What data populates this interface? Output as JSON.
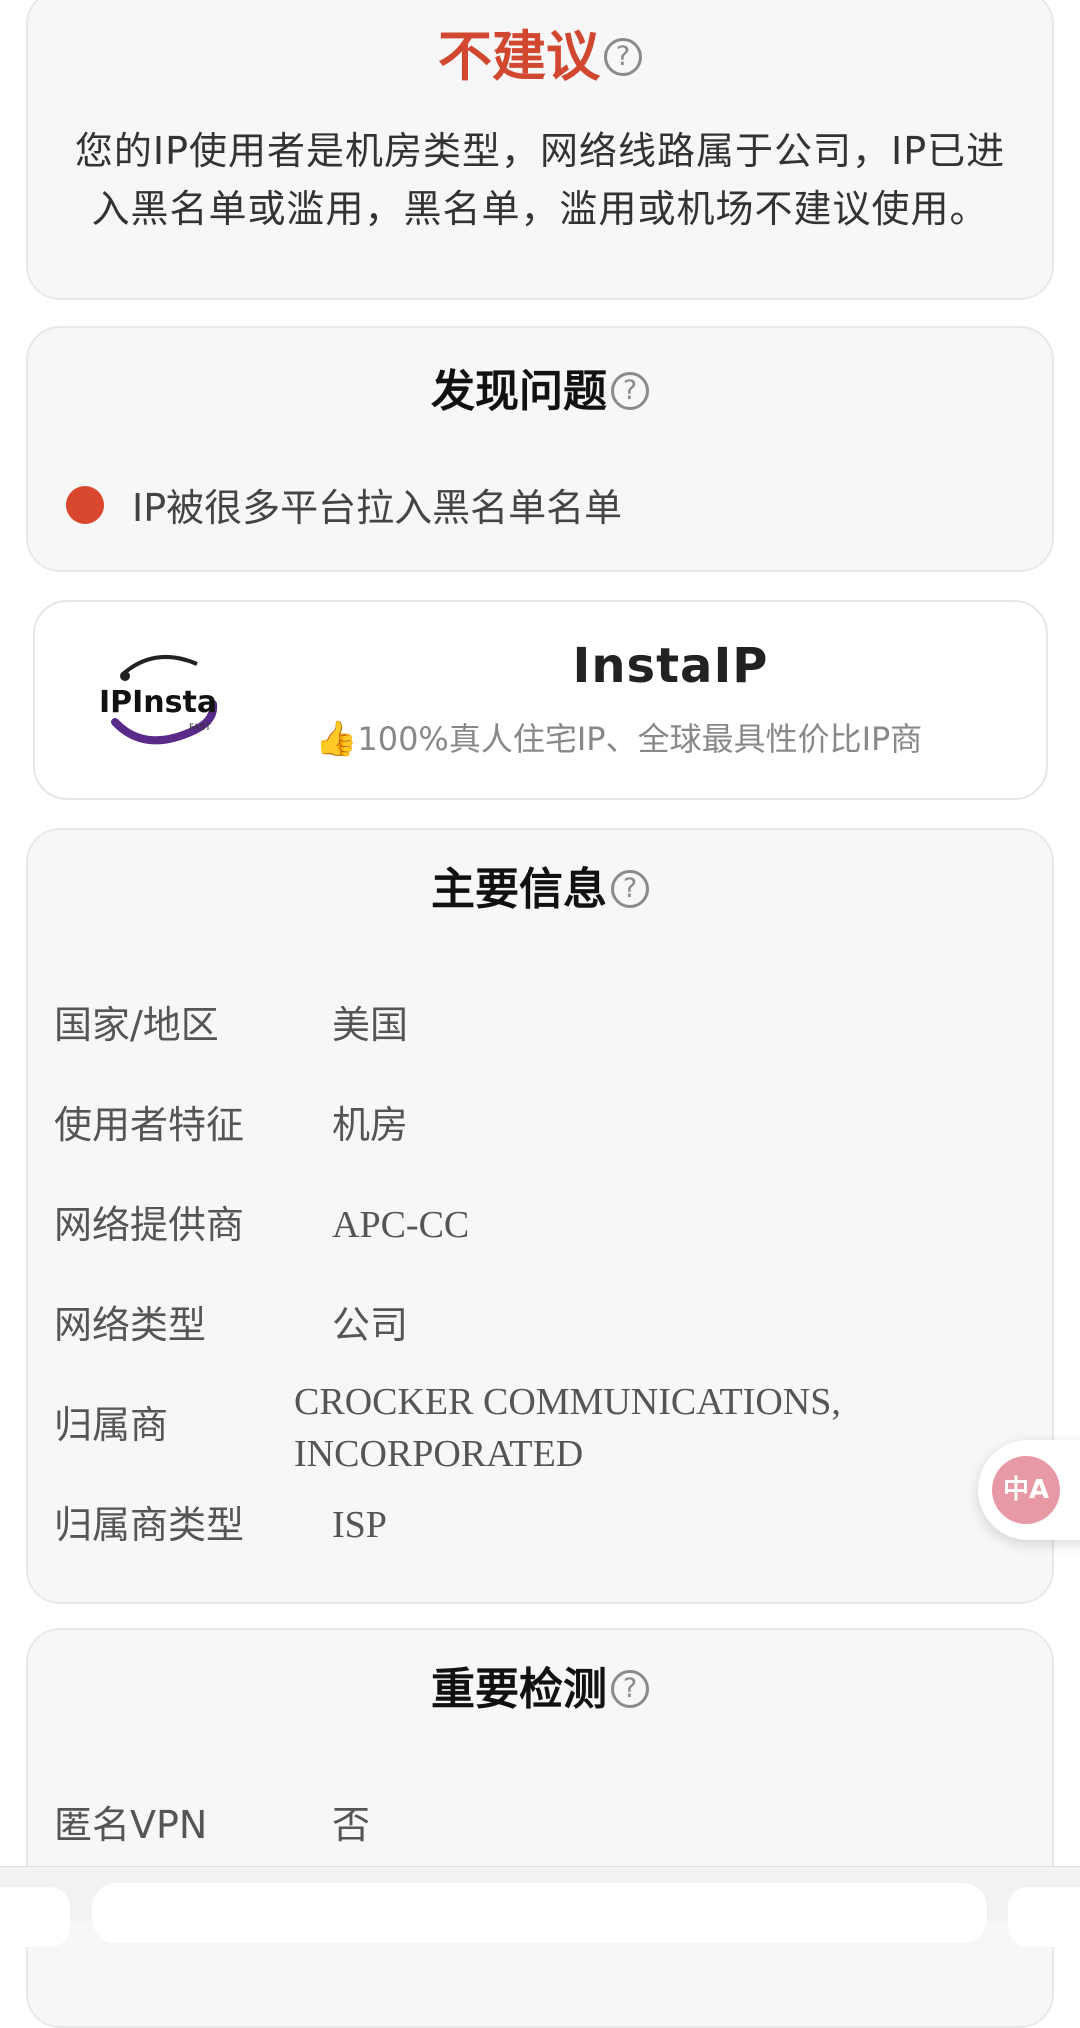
{
  "verdict": {
    "title": "不建议",
    "help": "?",
    "description": "您的IP使用者是机房类型，网络线路属于公司，IP已进入黑名单或滥用，黑名单，滥用或机场不建议使用。"
  },
  "issues": {
    "title": "发现问题",
    "help": "?",
    "items": [
      {
        "text": "IP被很多平台拉入黑名单名单",
        "color": "#d9472e"
      }
    ]
  },
  "ad": {
    "logo_text": "IPInsta",
    "logo_sub": "FAST",
    "title": "InstaIP",
    "thumb": "👍",
    "subtitle": "100%真人住宅IP、全球最具性价比IP商"
  },
  "main_info": {
    "title": "主要信息",
    "help": "?",
    "rows": [
      {
        "label": "国家/地区",
        "value": "美国"
      },
      {
        "label": "使用者特征",
        "value": "机房"
      },
      {
        "label": "网络提供商",
        "value": "APC-CC"
      },
      {
        "label": "网络类型",
        "value": "公司"
      },
      {
        "label": "归属商",
        "value": "CROCKER COMMUNICATIONS, INCORPORATED"
      },
      {
        "label": "归属商类型",
        "value": "ISP"
      }
    ]
  },
  "checks": {
    "title": "重要检测",
    "help": "?",
    "rows": [
      {
        "label": "匿名VPN",
        "value": "否"
      }
    ]
  },
  "translate_fab": {
    "icon": "translate-icon",
    "text": "中A"
  },
  "colors": {
    "danger": "#d2472f",
    "accent_pink": "#e79aa6"
  }
}
